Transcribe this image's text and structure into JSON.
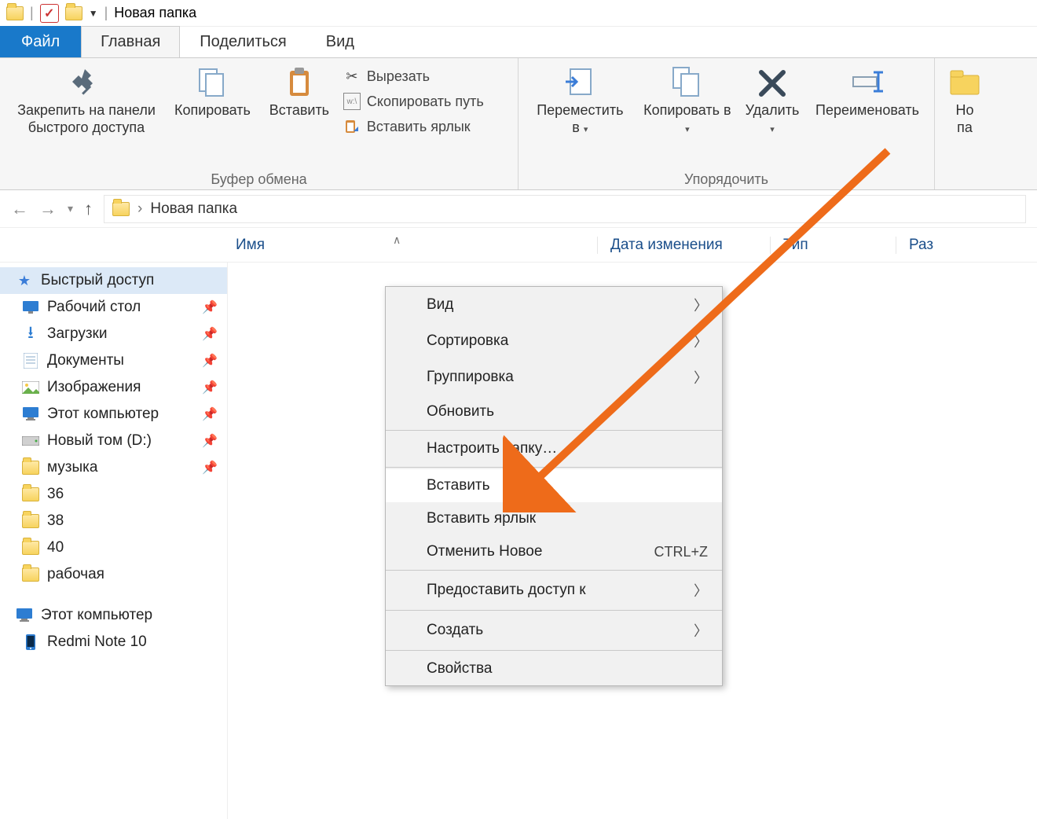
{
  "titlebar": {
    "title": "Новая папка"
  },
  "tabs": {
    "file": "Файл",
    "home": "Главная",
    "share": "Поделиться",
    "view": "Вид"
  },
  "ribbon": {
    "clipboard": {
      "pin": "Закрепить на панели\nбыстрого доступа",
      "copy": "Копировать",
      "paste": "Вставить",
      "cut": "Вырезать",
      "copy_path": "Скопировать путь",
      "paste_shortcut": "Вставить ярлык",
      "group_label": "Буфер обмена"
    },
    "organize": {
      "move_to": "Переместить в",
      "copy_to": "Копировать в",
      "delete": "Удалить",
      "rename": "Переименовать",
      "group_label": "Упорядочить"
    },
    "new": {
      "new_folder_partial": "Но\nпа"
    }
  },
  "nav": {
    "breadcrumb": "Новая папка"
  },
  "columns": {
    "name": "Имя",
    "date": "Дата изменения",
    "type": "Тип",
    "size": "Раз"
  },
  "sidebar": {
    "quick_access": "Быстрый доступ",
    "items": [
      {
        "label": "Рабочий стол",
        "icon": "desktop",
        "pinned": true
      },
      {
        "label": "Загрузки",
        "icon": "downloads",
        "pinned": true
      },
      {
        "label": "Документы",
        "icon": "documents",
        "pinned": true
      },
      {
        "label": "Изображения",
        "icon": "pictures",
        "pinned": true
      },
      {
        "label": "Этот компьютер",
        "icon": "pc",
        "pinned": true
      },
      {
        "label": "Новый том (D:)",
        "icon": "drive",
        "pinned": true
      },
      {
        "label": "музыка",
        "icon": "folder",
        "pinned": true
      },
      {
        "label": "36",
        "icon": "folder",
        "pinned": false
      },
      {
        "label": "38",
        "icon": "folder",
        "pinned": false
      },
      {
        "label": "40",
        "icon": "folder",
        "pinned": false
      },
      {
        "label": "рабочая",
        "icon": "folder",
        "pinned": false
      }
    ],
    "this_pc": "Этот компьютер",
    "device": "Redmi Note 10"
  },
  "context_menu": {
    "view": "Вид",
    "sort": "Сортировка",
    "group": "Группировка",
    "refresh": "Обновить",
    "customize": "Настроить папку…",
    "paste": "Вставить",
    "paste_shortcut": "Вставить ярлык",
    "undo": "Отменить Новое",
    "undo_shortcut": "CTRL+Z",
    "share_access": "Предоставить доступ к",
    "create": "Создать",
    "properties": "Свойства"
  }
}
